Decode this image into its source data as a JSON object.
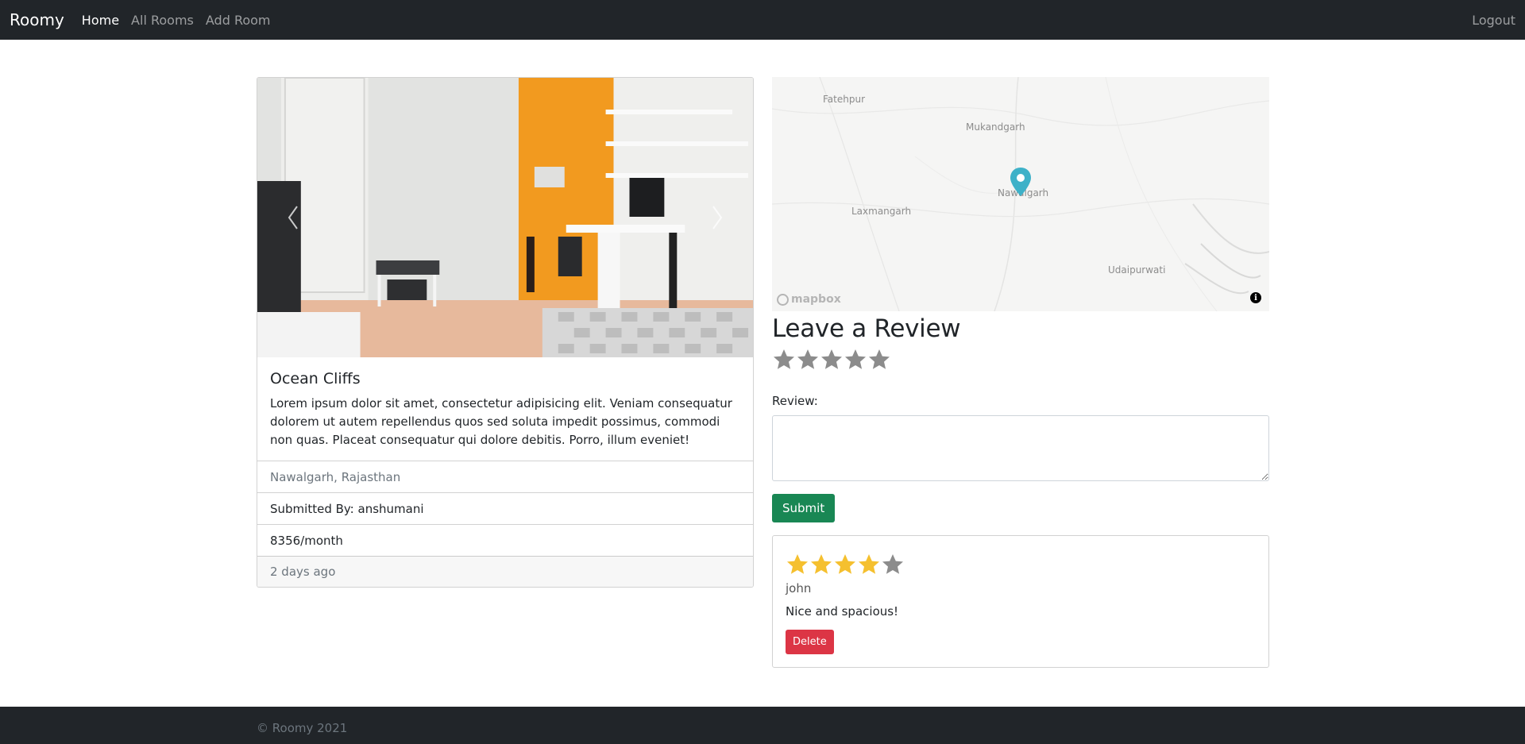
{
  "nav": {
    "brand": "Roomy",
    "links": [
      {
        "label": "Home"
      },
      {
        "label": "All Rooms"
      },
      {
        "label": "Add Room"
      }
    ],
    "logout": "Logout"
  },
  "room": {
    "title": "Ocean Cliffs",
    "description": "Lorem ipsum dolor sit amet, consectetur adipisicing elit. Veniam consequatur dolorem ut autem repellendus quos sed soluta impedit possimus, commodi non quas. Placeat consequatur qui dolore debitis. Porro, illum eveniet!",
    "location": "Nawalgarh, Rajasthan",
    "submitted_by": "Submitted By: anshumani",
    "price": "8356/month",
    "posted": "2 days ago"
  },
  "map": {
    "labels": [
      "Fatehpur",
      "Mukandgarh",
      "Nawalgarh",
      "Laxmangarh",
      "Udaipurwati"
    ],
    "logo": "mapbox",
    "info_icon": "i"
  },
  "review_form": {
    "heading": "Leave a Review",
    "label": "Review:",
    "submit": "Submit",
    "rating": 0,
    "max_rating": 5
  },
  "reviews": [
    {
      "rating": 4,
      "max_rating": 5,
      "author": "john",
      "text": "Nice and spacious!",
      "delete": "Delete"
    }
  ],
  "footer": {
    "text": "© Roomy 2021"
  },
  "colors": {
    "navbar": "#212529",
    "star_filled": "#f5c02f",
    "star_empty": "#8c8c8c",
    "submit": "#198754",
    "delete": "#dc3545",
    "pin": "#3eb1c8",
    "accent_wall": "#f29a1f"
  }
}
